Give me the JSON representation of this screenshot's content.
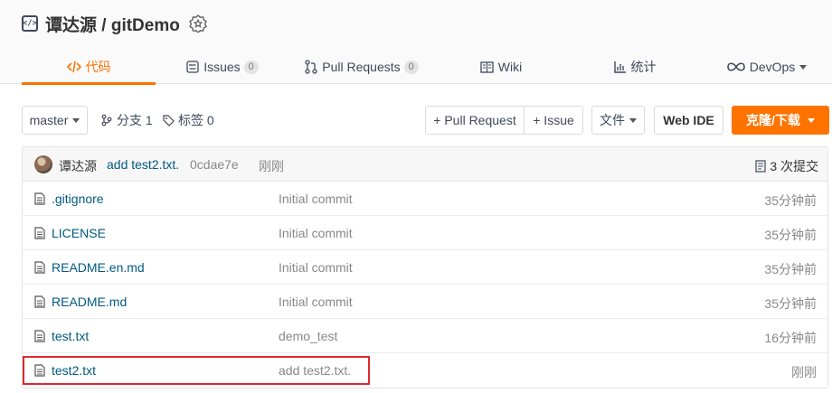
{
  "repo": {
    "type_icon": "code-repo-icon",
    "name": "谭达源 / gitDemo",
    "badge_icon": "star-badge-icon"
  },
  "tabs": [
    {
      "label": "代码",
      "icon": "code-icon",
      "active": true
    },
    {
      "label": "Issues",
      "icon": "issues-icon",
      "count": "0"
    },
    {
      "label": "Pull Requests",
      "icon": "pull-request-icon",
      "count": "0"
    },
    {
      "label": "Wiki",
      "icon": "wiki-icon"
    },
    {
      "label": "统计",
      "icon": "stats-icon"
    },
    {
      "label": "DevOps",
      "icon": "infinity-icon"
    }
  ],
  "toolbar": {
    "branch": "master",
    "branches_label": "分支 1",
    "tags_label": "标签 0",
    "pull_request_label": "+ Pull Request",
    "issue_label": "+ Issue",
    "file_label": "文件",
    "webide_label": "Web IDE",
    "clone_label": "克隆/下载"
  },
  "commit": {
    "author": "谭达源",
    "message": "add test2.txt.",
    "hash": "0cdae7e",
    "time": "刚刚",
    "count_label": "3 次提交"
  },
  "files": [
    {
      "name": ".gitignore",
      "message": "Initial commit",
      "time": "35分钟前"
    },
    {
      "name": "LICENSE",
      "message": "Initial commit",
      "time": "35分钟前"
    },
    {
      "name": "README.en.md",
      "message": "Initial commit",
      "time": "35分钟前"
    },
    {
      "name": "README.md",
      "message": "Initial commit",
      "time": "35分钟前"
    },
    {
      "name": "test.txt",
      "message": "demo_test",
      "time": "16分钟前"
    },
    {
      "name": "test2.txt",
      "message": "add test2.txt.",
      "time": "刚刚"
    }
  ],
  "colors": {
    "accent": "#fe7300",
    "link": "#005980",
    "highlight": "#e0282b"
  }
}
